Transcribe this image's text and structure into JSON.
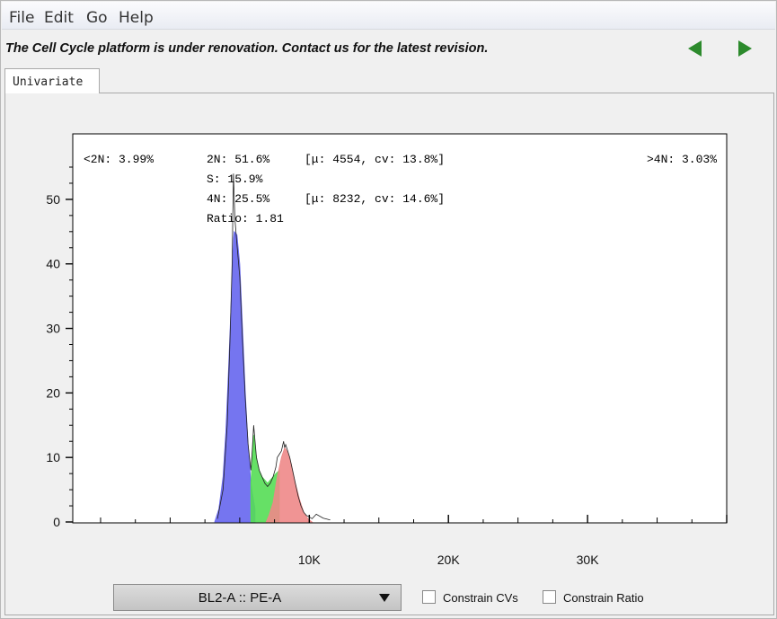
{
  "menu": {
    "file": "File",
    "edit": "Edit",
    "go": "Go",
    "help": "Help"
  },
  "banner": "The Cell Cycle platform is under renovation.  Contact us for the latest revision.",
  "tab": {
    "label": "Univariate"
  },
  "stats": {
    "lt2n": "<2N: 3.99%",
    "g1": "2N: 51.6%",
    "g1_peak": "[μ: 4554,  cv: 13.8%]",
    "s": "S: 15.9%",
    "g2": "4N: 25.5%",
    "g2_peak": "[μ: 8232,  cv: 14.6%]",
    "ratio": "Ratio: 1.81",
    "gt4n": ">4N: 3.03%"
  },
  "parameter_select": {
    "value": "BL2-A :: PE-A"
  },
  "options": {
    "constrain_cvs": "Constrain CVs",
    "constrain_ratio": "Constrain Ratio"
  },
  "colors": {
    "g1": "#6666ee",
    "s": "#55dd55",
    "g2": "#ee8888",
    "nav": "#2c8a2c"
  },
  "chart_data": {
    "type": "area",
    "xlim": [
      -7000,
      40000
    ],
    "ylim": [
      0,
      55
    ],
    "x_ticks": [
      10000,
      20000,
      30000
    ],
    "x_tick_labels": [
      "10K",
      "20K",
      "30K"
    ],
    "y_ticks": [
      0,
      10,
      20,
      30,
      40,
      50
    ],
    "y_tick_labels": [
      "0",
      "10",
      "20",
      "30",
      "40",
      "50"
    ],
    "series": [
      {
        "kind": "g1",
        "x": [
          3200,
          3500,
          3800,
          4000,
          4200,
          4400,
          4500,
          4554,
          4600,
          4800,
          5000,
          5200,
          5400,
          5600,
          5800,
          6100
        ],
        "y": [
          0,
          2,
          7,
          14,
          24,
          35,
          41,
          44,
          45,
          44.5,
          40,
          30,
          20,
          12,
          6,
          2
        ]
      },
      {
        "kind": "s",
        "x": [
          5800,
          6000,
          6200,
          6400,
          6600,
          6800,
          7000,
          7200,
          7400,
          7600,
          7850
        ],
        "y": [
          6,
          13.5,
          10,
          8,
          7,
          6.5,
          6,
          6.5,
          7,
          7.5,
          8
        ]
      },
      {
        "kind": "g2",
        "x": [
          6900,
          7100,
          7400,
          7700,
          8000,
          8232,
          8400,
          8700,
          9000,
          9300,
          9600,
          9900,
          10200
        ],
        "y": [
          0,
          1,
          3,
          7,
          10,
          11.5,
          11,
          9,
          6,
          3.5,
          1.5,
          0.5,
          0
        ]
      },
      {
        "kind": "raw",
        "x": [
          3400,
          3800,
          4100,
          4300,
          4450,
          4550,
          4650,
          4800,
          5000,
          5200,
          5400,
          5600,
          5800,
          5900,
          6000,
          6200,
          6400,
          6600,
          6800,
          7000,
          7200,
          7400,
          7600,
          7700,
          7850,
          8000,
          8150,
          8232,
          8300,
          8450,
          8600,
          8800,
          9000,
          9200,
          9400,
          9600,
          9800,
          10000,
          10200,
          10500,
          11000,
          11500
        ],
        "y": [
          0.5,
          5,
          15,
          28,
          40,
          54,
          47,
          43,
          38,
          28,
          19,
          12,
          8,
          11,
          15,
          10,
          8,
          7,
          6,
          5.5,
          6,
          7,
          8.5,
          10,
          10.5,
          11,
          12.5,
          11.5,
          12,
          11,
          10,
          8,
          6,
          4,
          2.5,
          1.5,
          1,
          0.8,
          0.5,
          1.2,
          0.6,
          0.3
        ]
      }
    ]
  }
}
